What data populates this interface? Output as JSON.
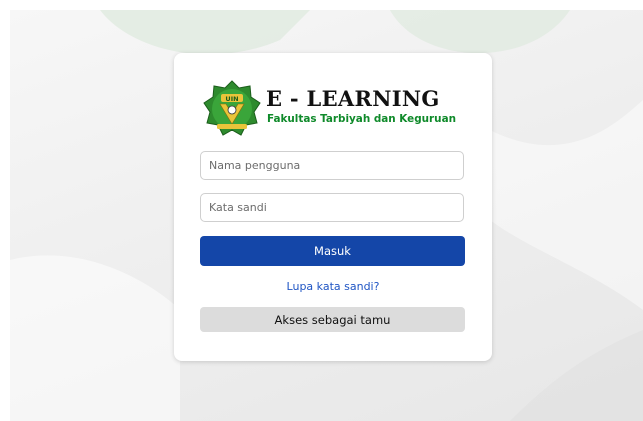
{
  "brand": {
    "title": "E - LEARNING",
    "subtitle": "Fakultas Tarbiyah dan Keguruan",
    "logo_icon": "uin-emblem-icon",
    "subtitle_color": "#0f8a2a"
  },
  "login_form": {
    "username_placeholder": "Nama pengguna",
    "password_placeholder": "Kata sandi",
    "submit_label": "Masuk",
    "submit_color": "#1446a8",
    "forgot_label": "Lupa kata sandi?",
    "forgot_color": "#1f55c4",
    "guest_label": "Akses sebagai tamu"
  }
}
